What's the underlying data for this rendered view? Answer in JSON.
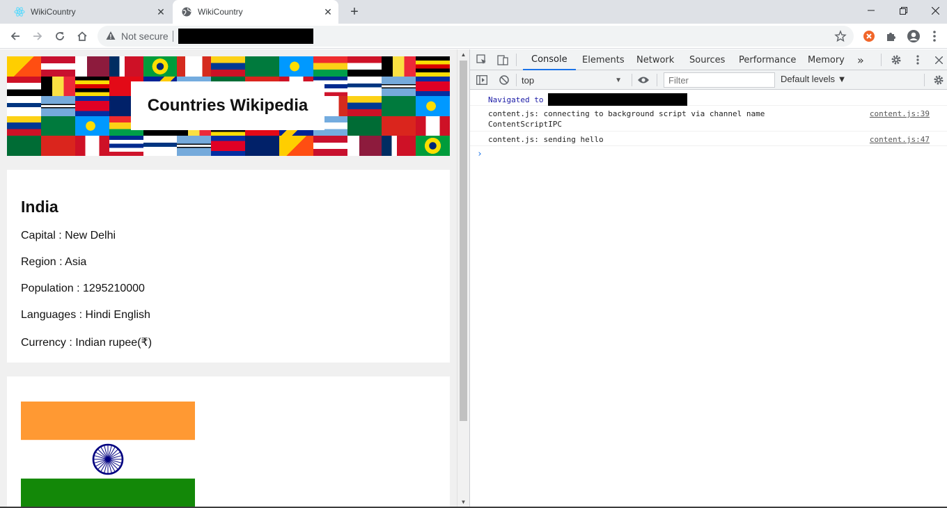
{
  "browser": {
    "tabs": [
      {
        "title": "WikiCountry",
        "active": false
      },
      {
        "title": "WikiCountry",
        "active": true
      }
    ],
    "security_label": "Not secure"
  },
  "page": {
    "banner_title": "Countries Wikipedia",
    "country": {
      "name": "India",
      "rows": [
        "Capital : New Delhi",
        "Region : Asia",
        "Population : 1295210000",
        "Languages : Hindi English",
        "Currency : Indian rupee(₹)"
      ]
    }
  },
  "devtools": {
    "tabs": [
      "Console",
      "Elements",
      "Network",
      "Sources",
      "Performance",
      "Memory"
    ],
    "more": "»",
    "context": "top",
    "filter_placeholder": "Filter",
    "levels": "Default levels ▼",
    "messages": [
      {
        "text": "Navigated to",
        "source": ""
      },
      {
        "text": "content.js: connecting to background script via channel name\nContentScriptIPC",
        "source": "content.js:39"
      },
      {
        "text": "content.js: sending hello",
        "source": "content.js:47"
      }
    ],
    "prompt": "›"
  },
  "colors": {
    "accent": "#1a73e8",
    "india_saffron": "#ff9933",
    "india_green": "#138808",
    "india_chakra": "#000080"
  }
}
